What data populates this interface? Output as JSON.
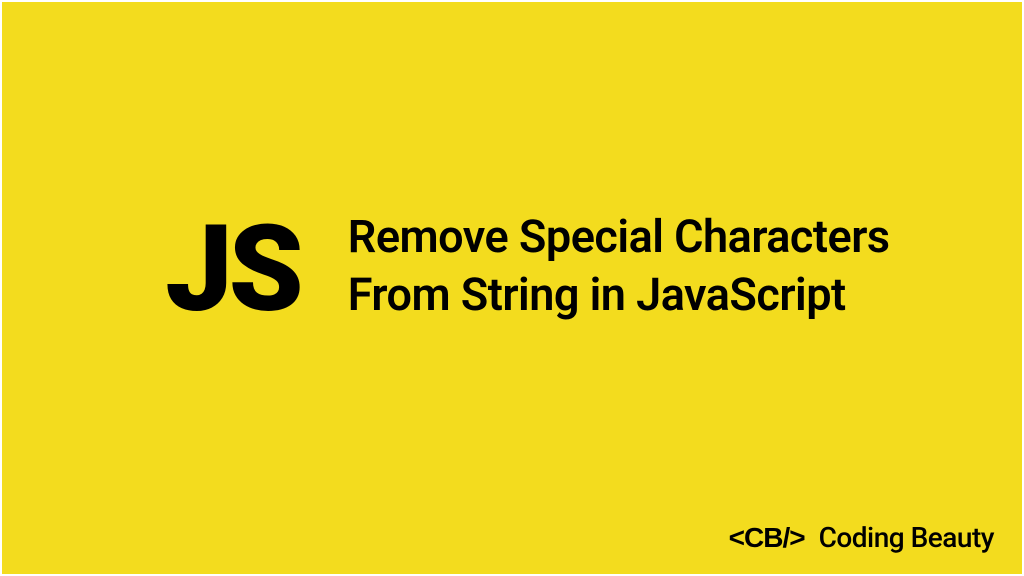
{
  "logo_text": "JS",
  "title": "Remove Special Characters From String in JavaScript",
  "attribution": {
    "tag": "<CB/>",
    "brand": "Coding Beauty"
  },
  "colors": {
    "background": "#f3dc1e",
    "text": "#000000"
  }
}
